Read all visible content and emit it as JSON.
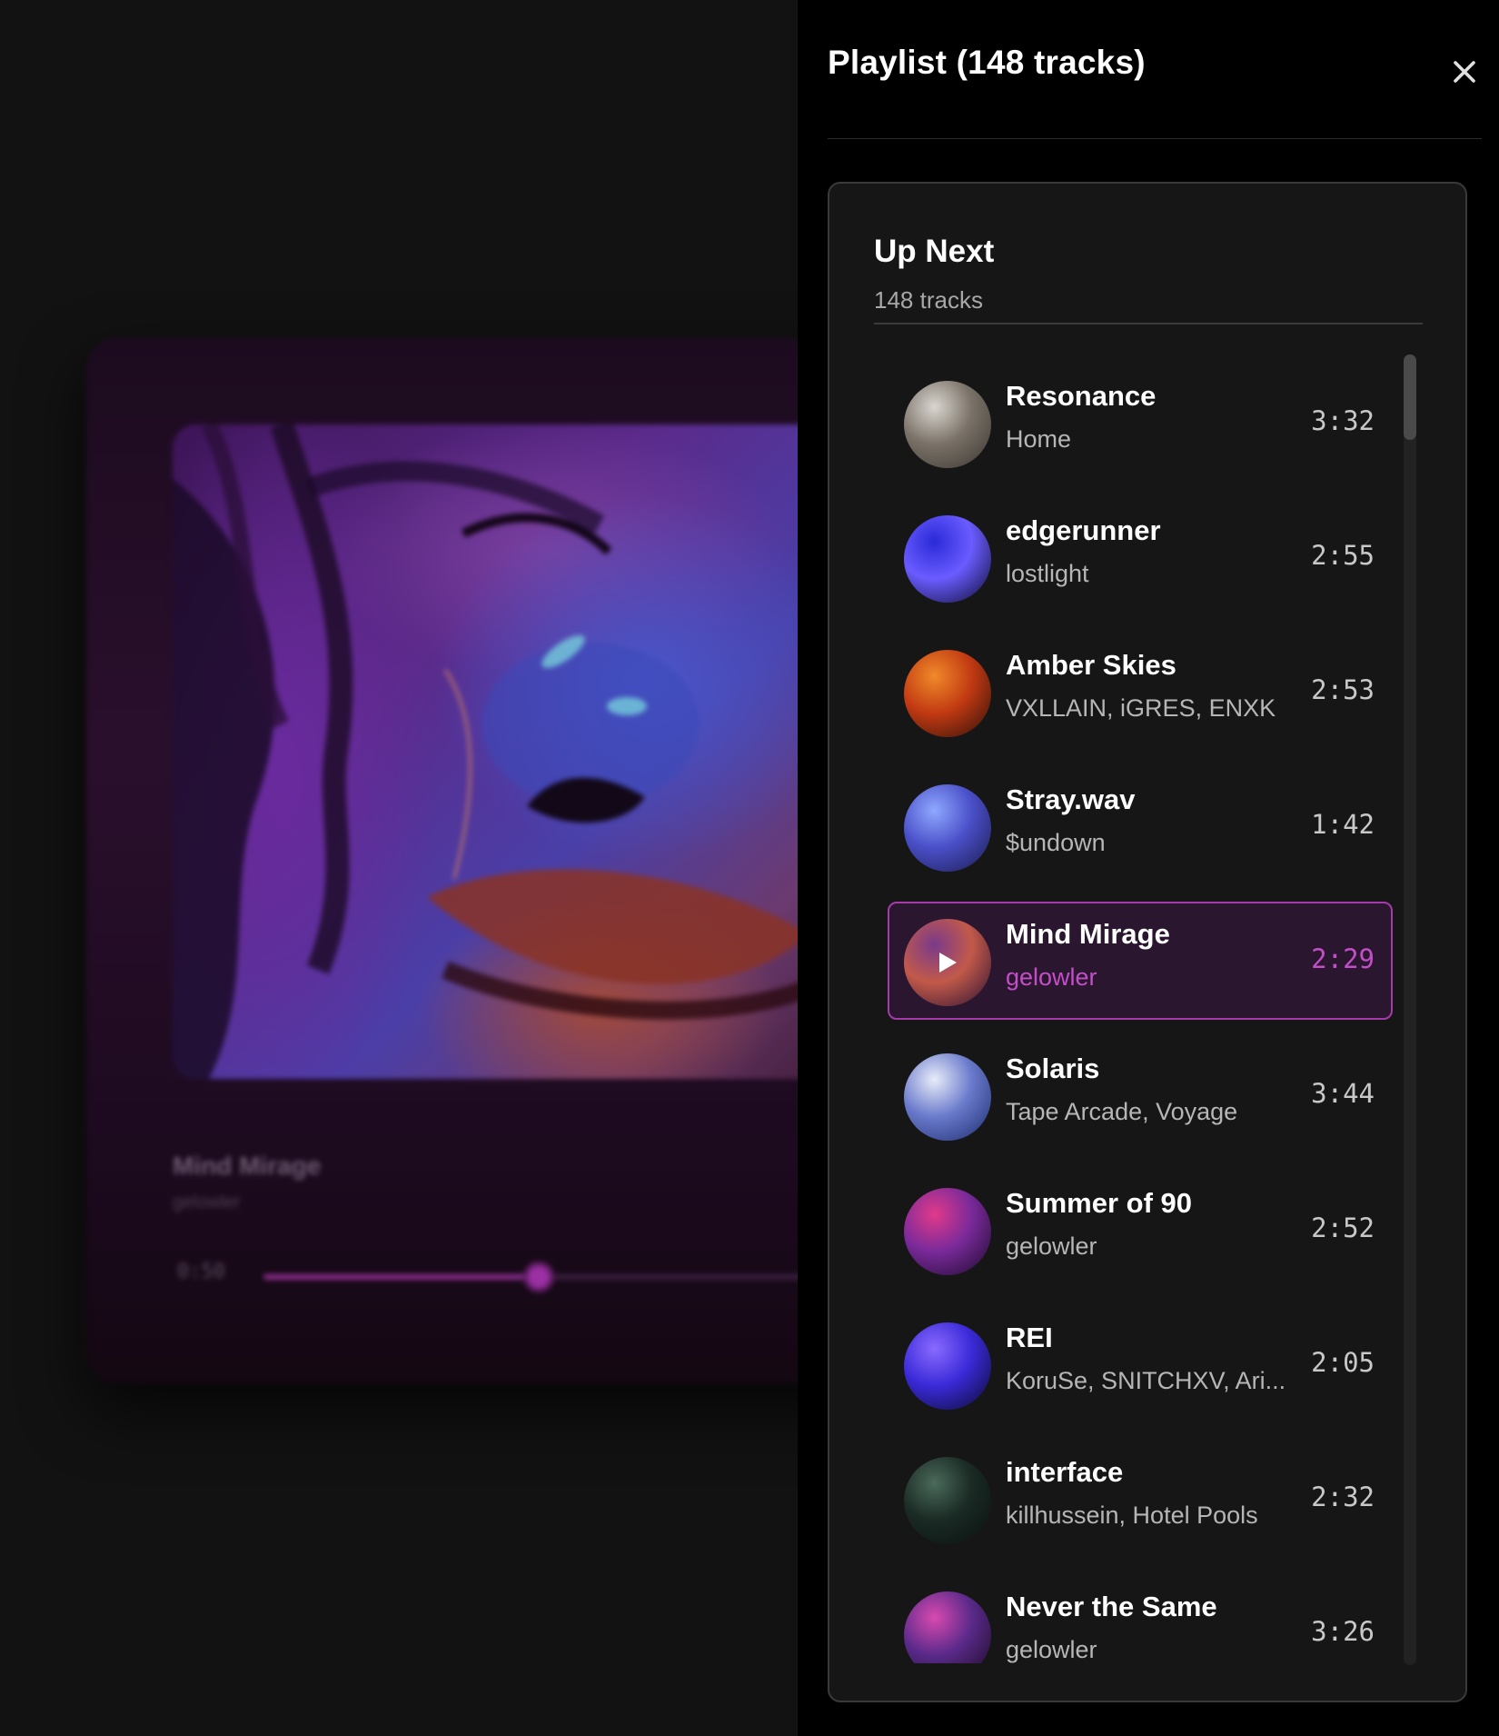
{
  "background_player": {
    "title": "Mind Mirage",
    "artist": "gelowler",
    "elapsed": "0:50",
    "progress": 0.43
  },
  "panel": {
    "title": "Playlist (148 tracks)",
    "close_icon": "close-icon"
  },
  "queue": {
    "heading": "Up Next",
    "count_label": "148 tracks",
    "tracks": [
      {
        "title": "Resonance",
        "artist": "Home",
        "duration": "3:32",
        "active": false,
        "art_colors": [
          "#d9d6d0",
          "#7a7268",
          "#3a3530"
        ]
      },
      {
        "title": "edgerunner",
        "artist": "lostlight",
        "duration": "2:55",
        "active": false,
        "art_colors": [
          "#2a2ad8",
          "#6a5cff",
          "#0a0a2a"
        ]
      },
      {
        "title": "Amber Skies",
        "artist": "VXLLAIN, iGRES, ENXK",
        "duration": "2:53",
        "active": false,
        "art_colors": [
          "#f08a2a",
          "#c23a12",
          "#2a0f0a"
        ]
      },
      {
        "title": "Stray.wav",
        "artist": "$undown",
        "duration": "1:42",
        "active": false,
        "art_colors": [
          "#8fa8ff",
          "#4a4fc8",
          "#1a1a4a"
        ]
      },
      {
        "title": "Mind Mirage",
        "artist": "gelowler",
        "duration": "2:29",
        "active": true,
        "art_colors": [
          "#7a3a8a",
          "#c25a4a",
          "#2a1030"
        ]
      },
      {
        "title": "Solaris",
        "artist": "Tape Arcade, Voyage",
        "duration": "3:44",
        "active": false,
        "art_colors": [
          "#e8ecf8",
          "#6a7acc",
          "#1a2a6a"
        ]
      },
      {
        "title": "Summer of 90",
        "artist": "gelowler",
        "duration": "2:52",
        "active": false,
        "art_colors": [
          "#e03a8a",
          "#7a2a9a",
          "#1a0a2a"
        ]
      },
      {
        "title": "REI",
        "artist": "KoruSe, SNITCHXV, Ari...",
        "duration": "2:05",
        "active": false,
        "art_colors": [
          "#8a6aff",
          "#3a2ad8",
          "#0a0a2a"
        ]
      },
      {
        "title": "interface",
        "artist": "killhussein, Hotel Pools",
        "duration": "2:32",
        "active": false,
        "art_colors": [
          "#4a6a5a",
          "#1a2a24",
          "#0a100e"
        ]
      },
      {
        "title": "Never the Same",
        "artist": "gelowler",
        "duration": "3:26",
        "active": false,
        "art_colors": [
          "#d84ab0",
          "#5a2a8a",
          "#1a0a20"
        ]
      }
    ]
  },
  "colors": {
    "accent": "#c24ec8",
    "active_bg": "#2b1630",
    "active_border": "#a53aa9"
  }
}
